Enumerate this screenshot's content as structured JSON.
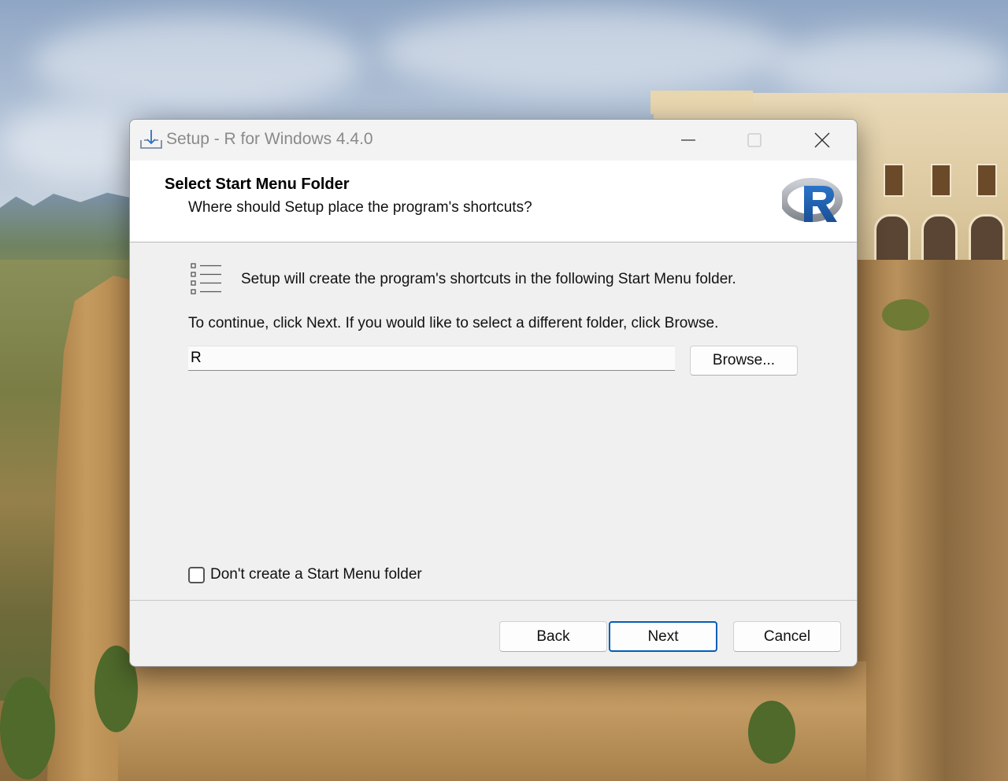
{
  "window": {
    "title": "Setup - R for Windows 4.4.0",
    "icon": "setup-download-icon",
    "controls": {
      "minimize": "minimize-icon",
      "maximize": "maximize-icon",
      "close": "close-icon"
    }
  },
  "header": {
    "title": "Select Start Menu Folder",
    "subtitle": "Where should Setup place the program's shortcuts?",
    "logo": "r-logo-icon"
  },
  "body": {
    "info_icon": "shortcut-list-icon",
    "info_text": "Setup will create the program's shortcuts in the following Start Menu folder.",
    "continue_text": "To continue, click Next. If you would like to select a different folder, click Browse.",
    "folder_value": "R",
    "browse_label": "Browse...",
    "no_folder_checkbox": {
      "label": "Don't create a Start Menu folder",
      "checked": false
    }
  },
  "footer": {
    "back_label": "Back",
    "next_label": "Next",
    "cancel_label": "Cancel"
  },
  "colors": {
    "accent": "#005fb8",
    "r_logo_blue": "#2266b8",
    "r_logo_gray": "#9a9ea6"
  }
}
